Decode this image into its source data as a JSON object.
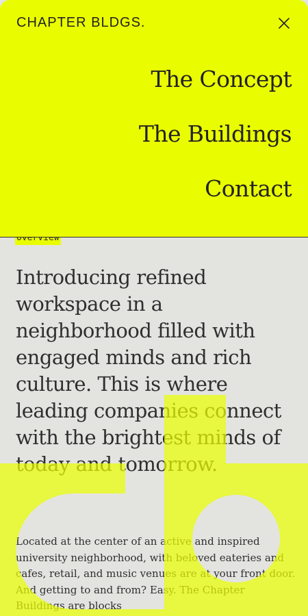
{
  "brand": {
    "logo": "CHAPTER BLDGS."
  },
  "nav": {
    "items": [
      {
        "label": "The Concept"
      },
      {
        "label": "The Buildings"
      },
      {
        "label": "Contact"
      }
    ]
  },
  "overview": {
    "tag": "Overview",
    "headline": "Introducing refined workspace in a neighborhood filled with engaged minds and rich culture. This is where leading companies connect with the brightest minds of today and tomorrow.",
    "body": "Located at the center of an active and inspired university neighborhood, with beloved eateries and cafes, retail, and music venues are at your front door. And getting to and from? Easy. The Chapter Buildings are blocks"
  },
  "colors": {
    "accent": "#eafd00",
    "background": "#e3e4e0",
    "ink": "#2f2f2f"
  },
  "icons": {
    "close": "close-icon"
  }
}
